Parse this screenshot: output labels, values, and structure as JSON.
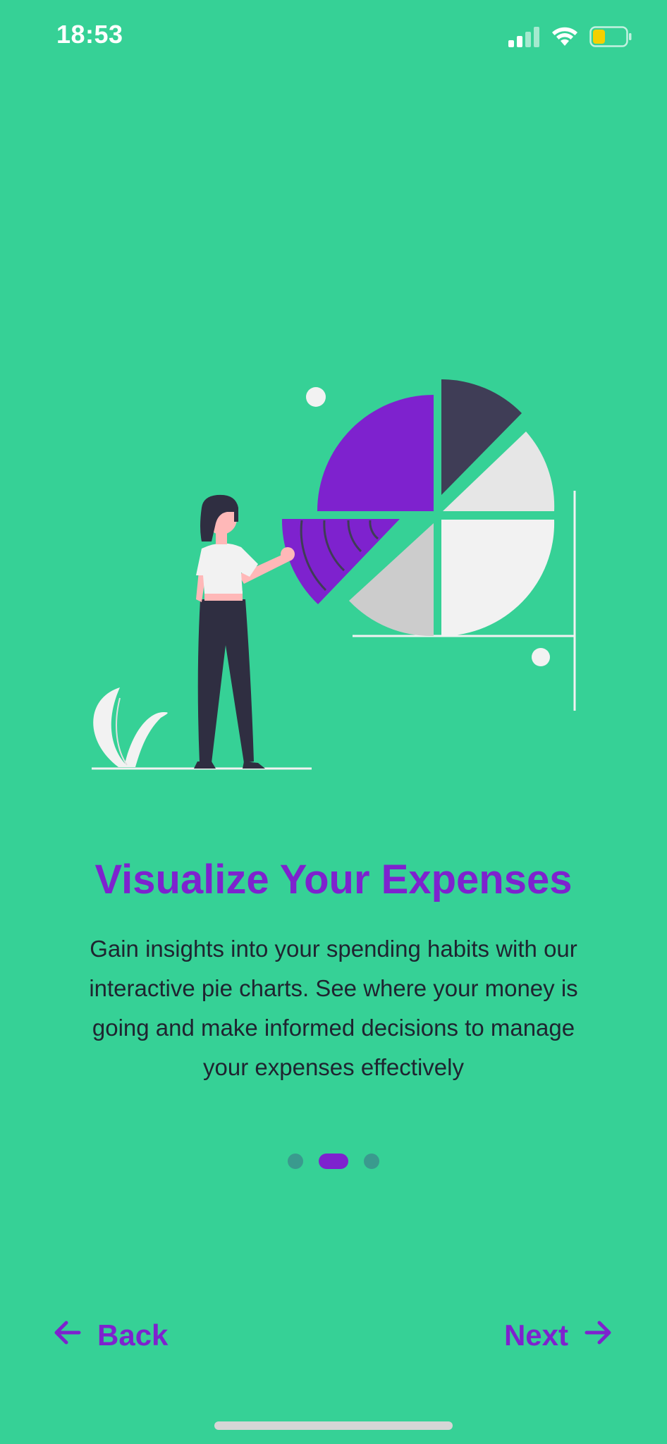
{
  "status_bar": {
    "time": "18:53",
    "icons": [
      "cellular-signal-icon",
      "wifi-icon",
      "battery-icon"
    ],
    "battery_color": "#F5D000"
  },
  "illustration": {
    "name": "woman-with-pie-chart-illustration",
    "colors": {
      "purple": "#7E22CE",
      "dark": "#3F3D56",
      "light_gray": "#E6E6E6",
      "mid_gray": "#CCCCCC",
      "white": "#F2F2F2",
      "skin": "#FFB8B8",
      "hair": "#2F2E41"
    }
  },
  "onboarding": {
    "title": "Visualize Your Expenses",
    "description": "Gain insights into your spending habits with our interactive pie charts. See where your money is going and make informed decisions to manage your expenses effectively",
    "page_indicator": {
      "total": 3,
      "active_index": 1
    }
  },
  "navigation": {
    "back_label": "Back",
    "next_label": "Next",
    "back_icon": "arrow-left-icon",
    "next_icon": "arrow-right-icon"
  },
  "theme": {
    "background": "#36D196",
    "accent": "#7E22CE",
    "inactive_dot": "#3A9A8E"
  }
}
